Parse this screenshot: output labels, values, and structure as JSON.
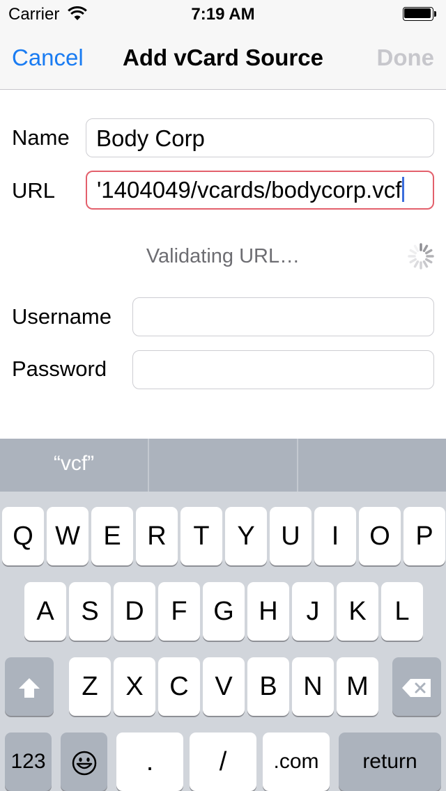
{
  "status": {
    "carrier": "Carrier",
    "time": "7:19 AM"
  },
  "nav": {
    "cancel_label": "Cancel",
    "title": "Add vCard Source",
    "done_label": "Done"
  },
  "form": {
    "name_label": "Name",
    "name_value": "Body Corp",
    "url_label": "URL",
    "url_value": "'1404049/vcards/bodycorp.vcf",
    "status_text": "Validating URL…",
    "username_label": "Username",
    "username_value": "",
    "password_label": "Password",
    "password_value": ""
  },
  "keyboard": {
    "suggestions": [
      "“vcf”",
      "",
      ""
    ],
    "row1": [
      "Q",
      "W",
      "E",
      "R",
      "T",
      "Y",
      "U",
      "I",
      "O",
      "P"
    ],
    "row2": [
      "A",
      "S",
      "D",
      "F",
      "G",
      "H",
      "J",
      "K",
      "L"
    ],
    "row3": [
      "Z",
      "X",
      "C",
      "V",
      "B",
      "N",
      "M"
    ],
    "numbers_label": "123",
    "period_label": ".",
    "slash_label": "/",
    "dotcom_label": ".com",
    "return_label": "return",
    "icons": {
      "shift": "shift-icon",
      "delete": "delete-icon",
      "emoji": "emoji-icon"
    }
  },
  "colors": {
    "accent": "#1a7cf2",
    "error_border": "#e3606c",
    "disabled": "#c7c7cc"
  }
}
